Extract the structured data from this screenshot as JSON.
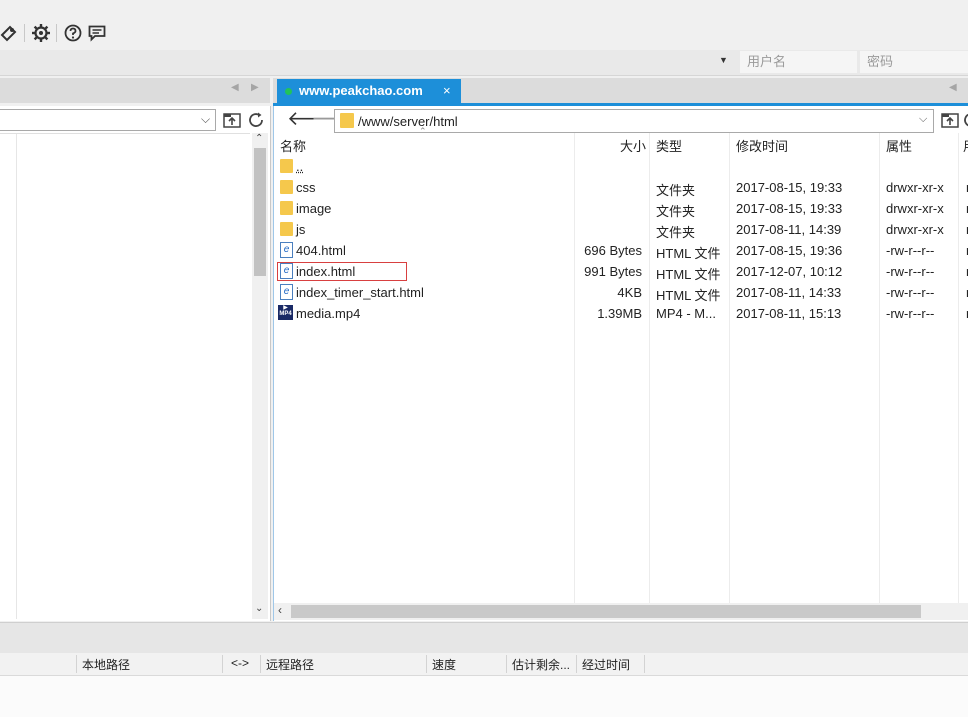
{
  "login": {
    "username_placeholder": "用户名",
    "password_placeholder": "密码"
  },
  "tab": {
    "title": "www.peakchao.com",
    "close": "×"
  },
  "path": {
    "current": "/www/server/html"
  },
  "columns": {
    "name": "名称",
    "size": "大小",
    "type": "类型",
    "modified": "修改时间",
    "attributes": "属性",
    "extra": "用"
  },
  "files": [
    {
      "name": "..",
      "size": "",
      "type": "",
      "modified": "",
      "attr": "",
      "extra": "",
      "icon": "folder-icon"
    },
    {
      "name": "css",
      "size": "",
      "type": "文件夹",
      "modified": "2017-08-15, 19:33",
      "attr": "drwxr-xr-x",
      "extra": "r",
      "icon": "folder-icon"
    },
    {
      "name": "image",
      "size": "",
      "type": "文件夹",
      "modified": "2017-08-15, 19:33",
      "attr": "drwxr-xr-x",
      "extra": "r",
      "icon": "folder-icon"
    },
    {
      "name": "js",
      "size": "",
      "type": "文件夹",
      "modified": "2017-08-11, 14:39",
      "attr": "drwxr-xr-x",
      "extra": "r",
      "icon": "folder-icon"
    },
    {
      "name": "404.html",
      "size": "696 Bytes",
      "type": "HTML 文件",
      "modified": "2017-08-15, 19:36",
      "attr": "-rw-r--r--",
      "extra": "r",
      "icon": "html-file-icon"
    },
    {
      "name": "index.html",
      "size": "991 Bytes",
      "type": "HTML 文件",
      "modified": "2017-12-07, 10:12",
      "attr": "-rw-r--r--",
      "extra": "r",
      "icon": "html-file-icon"
    },
    {
      "name": "index_timer_start.html",
      "size": "4KB",
      "type": "HTML 文件",
      "modified": "2017-08-11, 14:33",
      "attr": "-rw-r--r--",
      "extra": "r",
      "icon": "html-file-icon"
    },
    {
      "name": "media.mp4",
      "size": "1.39MB",
      "type": "MP4 - M...",
      "modified": "2017-08-11, 15:13",
      "attr": "-rw-r--r--",
      "extra": "r",
      "icon": "mp4-file-icon"
    }
  ],
  "icons": {
    "html": "e",
    "mp4": "MP4"
  },
  "queue": {
    "local_path": "本地路径",
    "direction": "<->",
    "remote_path": "远程路径",
    "speed": "速度",
    "remaining": "估计剩余...",
    "elapsed": "经过时间"
  },
  "colors": {
    "accent": "#1d8fd9",
    "status_dot": "#22c35a",
    "folder": "#f5c84c",
    "selection_border": "#d84040"
  }
}
